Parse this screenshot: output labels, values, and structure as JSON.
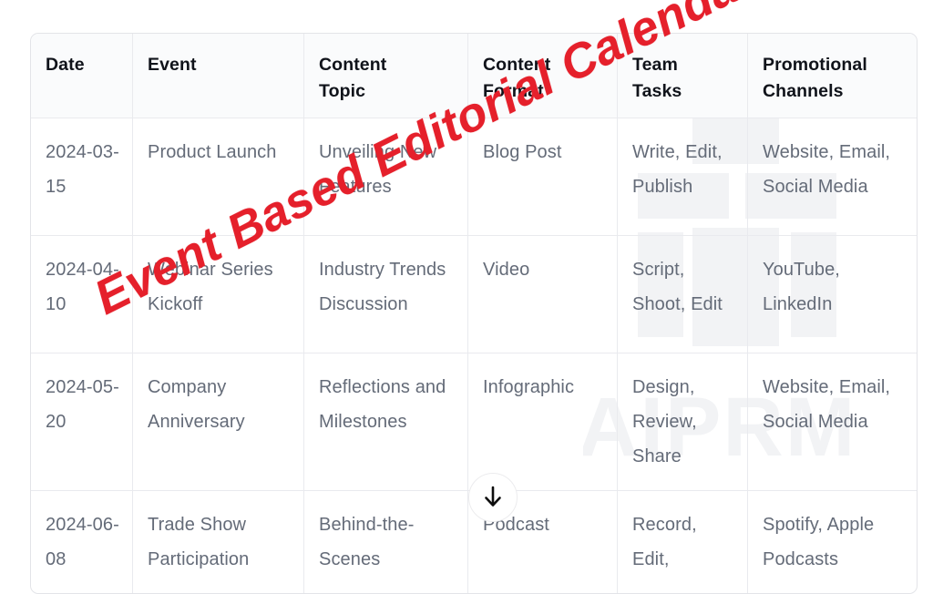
{
  "watermarks": {
    "title": "Event Based Editorial Calendar",
    "title_color": "#e5202b",
    "brand": "AIPRM",
    "brand_color": "#f2f3f5"
  },
  "download_button": {
    "icon": "download-arrow-icon",
    "label": ""
  },
  "table": {
    "columns": [
      {
        "key": "date",
        "line1": "Date",
        "line2": ""
      },
      {
        "key": "event",
        "line1": "Event",
        "line2": ""
      },
      {
        "key": "topic",
        "line1": "Content",
        "line2": "Topic"
      },
      {
        "key": "format",
        "line1": "Content",
        "line2": "Format"
      },
      {
        "key": "tasks",
        "line1": "Team",
        "line2": "Tasks"
      },
      {
        "key": "promo",
        "line1": "Promotional",
        "line2": "Channels"
      }
    ],
    "rows": [
      {
        "date": "2024-03-15",
        "event": "Product Launch",
        "topic": "Unveiling New Features",
        "format": "Blog Post",
        "tasks": "Write, Edit, Publish",
        "promo": "Website, Email, Social Media"
      },
      {
        "date": "2024-04-10",
        "event": "Webinar Series Kickoff",
        "topic": "Industry Trends Discussion",
        "format": "Video",
        "tasks": "Script, Shoot, Edit",
        "promo": "YouTube, LinkedIn"
      },
      {
        "date": "2024-05-20",
        "event": "Company Anniversary",
        "topic": "Reflections and Milestones",
        "format": "Infographic",
        "tasks": "Design, Review, Share",
        "promo": "Website, Email, Social Media"
      },
      {
        "date": "2024-06-08",
        "event": "Trade Show Participation",
        "topic": "Behind-the-Scenes",
        "format": "Podcast",
        "tasks": "Record, Edit,",
        "promo": "Spotify, Apple Podcasts"
      }
    ]
  }
}
